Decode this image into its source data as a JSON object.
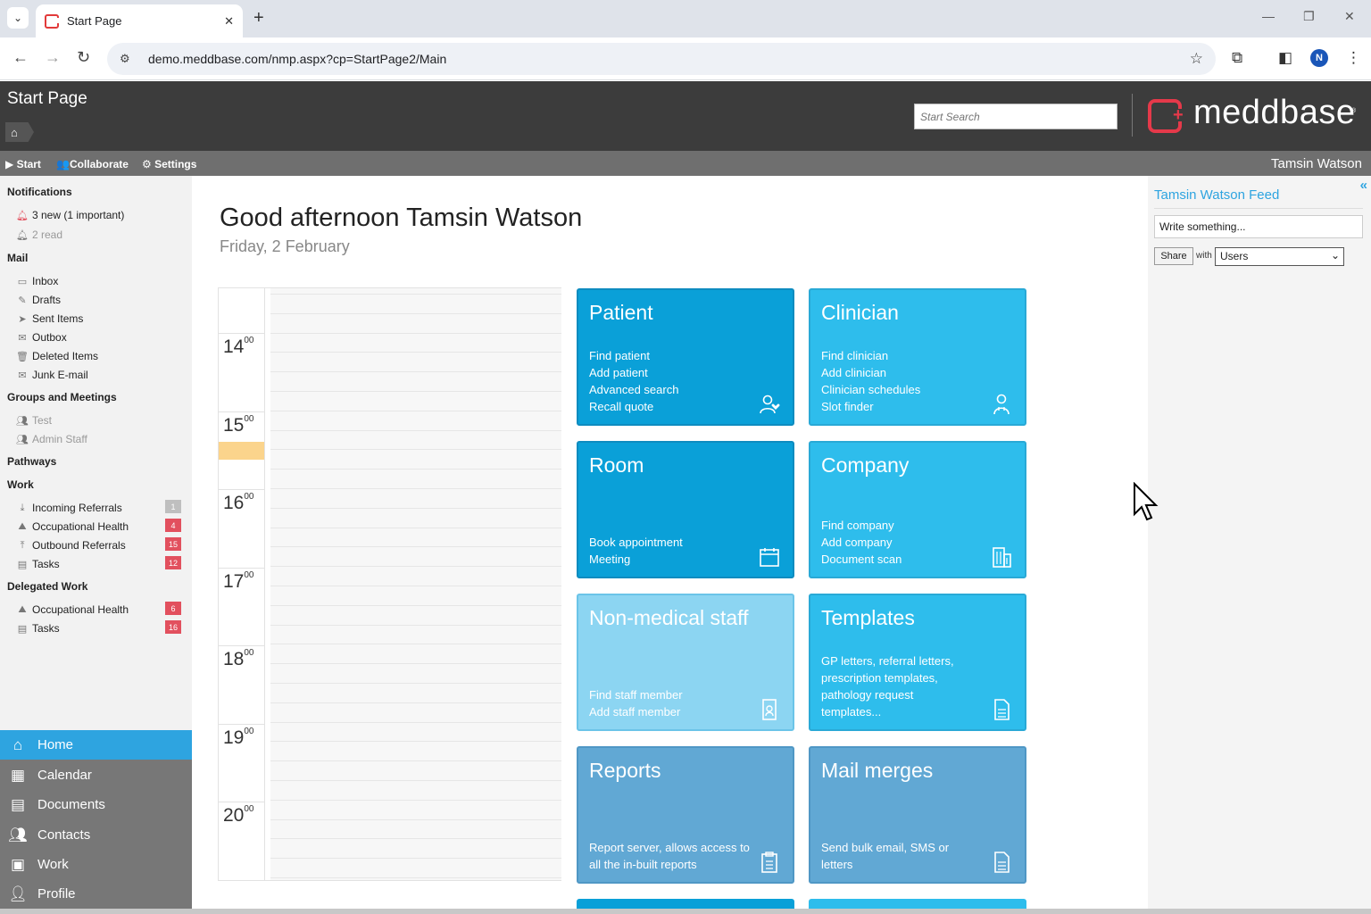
{
  "browser": {
    "tab_title": "Start Page",
    "tab_close": "✕",
    "new_tab": "+",
    "url": "demo.meddbase.com/nmp.aspx?cp=StartPage2/Main",
    "profile_initial": "N"
  },
  "header": {
    "page_title": "Start Page",
    "search_placeholder": "Start Search",
    "logo_text": "meddbase",
    "logo_reg": "®"
  },
  "menubar": {
    "start": "Start",
    "collaborate": "Collaborate",
    "settings": "Settings",
    "user_name": "Tamsin Watson"
  },
  "sidebar": {
    "notifications": {
      "heading": "Notifications",
      "new": "3 new (1 important)",
      "read": "2 read"
    },
    "mail": {
      "heading": "Mail",
      "items": [
        "Inbox",
        "Drafts",
        "Sent Items",
        "Outbox",
        "Deleted Items",
        "Junk E-mail"
      ]
    },
    "groups": {
      "heading": "Groups and Meetings",
      "items": [
        "Test",
        "Admin Staff"
      ]
    },
    "pathways": {
      "heading": "Pathways"
    },
    "work": {
      "heading": "Work",
      "items": [
        {
          "label": "Incoming Referrals",
          "count": "1"
        },
        {
          "label": "Occupational Health",
          "count": "4"
        },
        {
          "label": "Outbound Referrals",
          "count": "15"
        },
        {
          "label": "Tasks",
          "count": "12"
        }
      ]
    },
    "delegated": {
      "heading": "Delegated Work",
      "items": [
        {
          "label": "Occupational Health",
          "count": "6"
        },
        {
          "label": "Tasks",
          "count": "16"
        }
      ]
    }
  },
  "bottom_nav": [
    "Home",
    "Calendar",
    "Documents",
    "Contacts",
    "Work",
    "Profile"
  ],
  "main": {
    "greeting": "Good afternoon Tamsin Watson",
    "date": "Friday, 2 February"
  },
  "calendar": {
    "hours": [
      "14",
      "15",
      "16",
      "17",
      "18",
      "19",
      "20"
    ],
    "minutes": "00"
  },
  "tiles": [
    {
      "title": "Patient",
      "lines": [
        "Find patient",
        "Add patient",
        "Advanced search",
        "Recall quote"
      ]
    },
    {
      "title": "Clinician",
      "lines": [
        "Find clinician",
        "Add clinician",
        "Clinician schedules",
        "Slot finder"
      ]
    },
    {
      "title": "Room",
      "lines": [
        "Book appointment",
        "Meeting"
      ]
    },
    {
      "title": "Company",
      "lines": [
        "Find company",
        "Add company",
        "Document scan"
      ]
    },
    {
      "title": "Non-medical staff",
      "lines": [
        "Find staff member",
        "Add staff member"
      ]
    },
    {
      "title": "Templates",
      "lines": [
        "GP letters, referral letters,",
        "prescription templates,",
        "pathology request",
        "templates..."
      ]
    },
    {
      "title": "Reports",
      "lines": [
        "Report server, allows access to",
        "all the in-built reports"
      ]
    },
    {
      "title": "Mail merges",
      "lines": [
        "Send bulk email, SMS or",
        "letters"
      ]
    }
  ],
  "feed": {
    "title": "Tamsin Watson Feed",
    "input_value": "Write something...",
    "share": "Share",
    "with": "with",
    "audience": "Users",
    "collapse": "«"
  }
}
